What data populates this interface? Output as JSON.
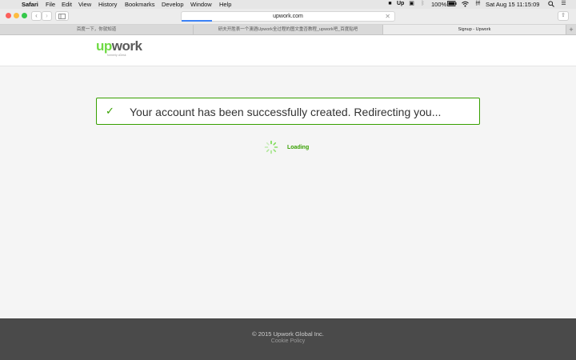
{
  "menubar": {
    "app": "Safari",
    "items": [
      "File",
      "Edit",
      "View",
      "History",
      "Bookmarks",
      "Develop",
      "Window",
      "Help"
    ],
    "battery": "100%",
    "clock": "Sat Aug 15  11:15:09"
  },
  "browser": {
    "url": "upwork.com",
    "tabs": [
      "百度一下，你就知道",
      "研夫开胜表一个澳酒Upwork全过程的图文重否教程_upwork吧_百度贴吧",
      "Signup - Upwork"
    ]
  },
  "header": {
    "logo_up": "up",
    "logo_work": "work",
    "tagline": "formerly oDesk"
  },
  "main": {
    "success_message": "Your account has been successfully created. Redirecting you...",
    "loading_label": "Loading"
  },
  "footer": {
    "copyright": "© 2015 Upwork Global Inc.",
    "cookie_policy": "Cookie Policy"
  },
  "colors": {
    "brand_green": "#37a000",
    "logo_green": "#6fda44",
    "footer_bg": "#4a4a4a"
  },
  "icons": [
    "apple-icon",
    "wifi-icon",
    "battery-icon",
    "search-icon",
    "list-icon",
    "check-icon",
    "spinner-icon",
    "share-icon",
    "sidebar-icon"
  ]
}
